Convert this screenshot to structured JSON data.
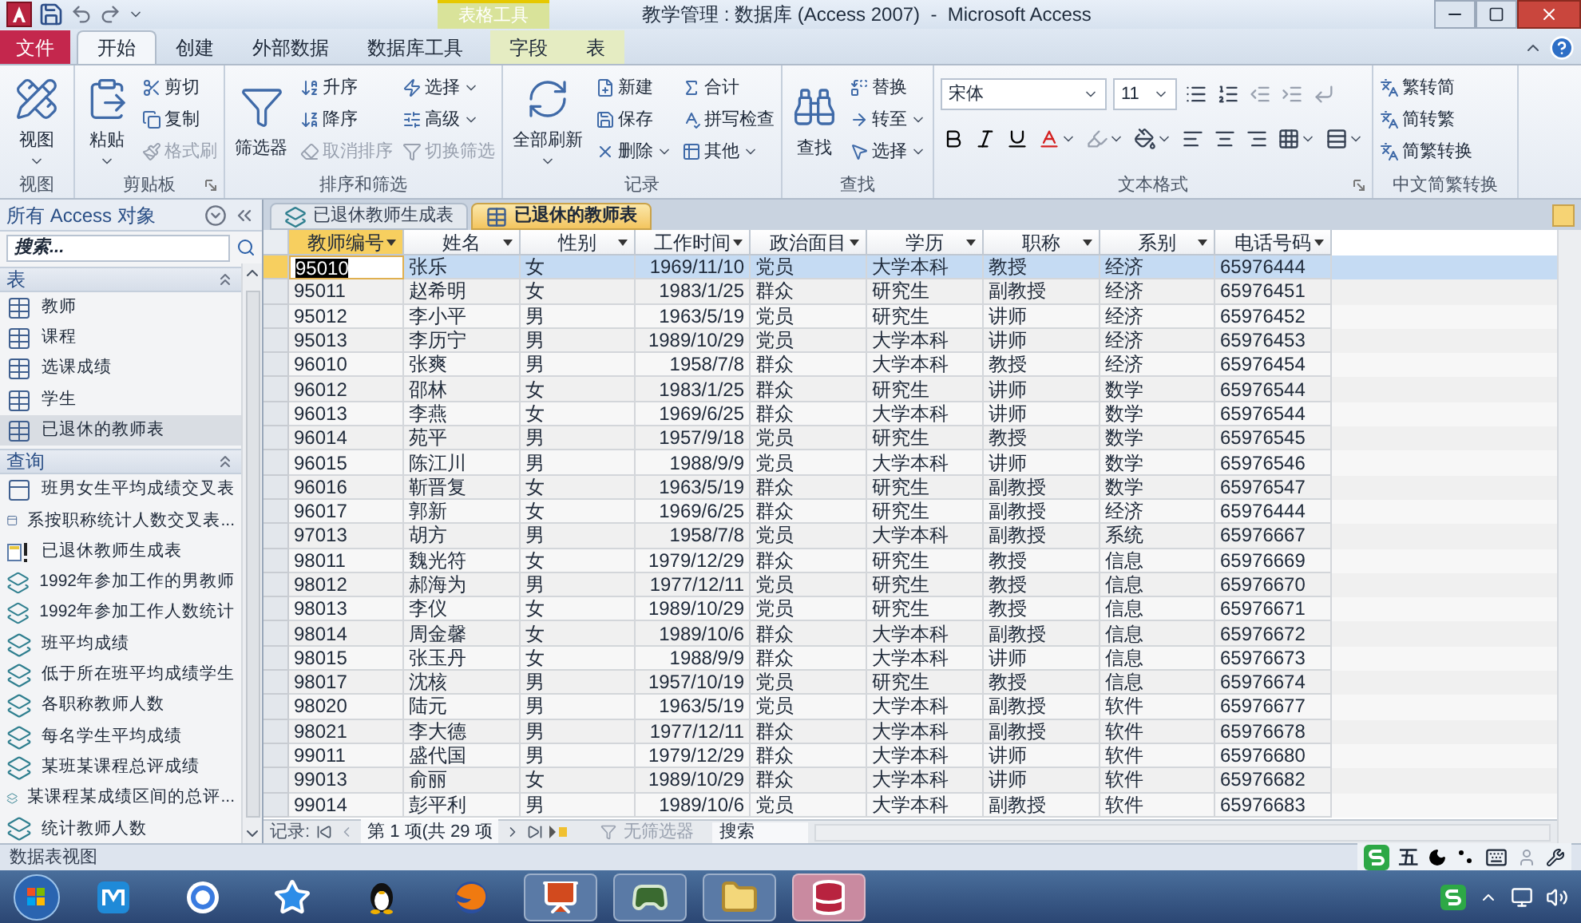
{
  "window": {
    "title": "教学管理 : 数据库 (Access 2007)  -  Microsoft Access"
  },
  "contextual_tab": {
    "label": "表格工具"
  },
  "ribbon_tabs": [
    {
      "label": "文件",
      "kind": "file",
      "selected": false
    },
    {
      "label": "开始",
      "kind": "normal",
      "selected": true
    },
    {
      "label": "创建",
      "kind": "normal",
      "selected": false
    },
    {
      "label": "外部数据",
      "kind": "normal",
      "selected": false
    },
    {
      "label": "数据库工具",
      "kind": "normal",
      "selected": false
    },
    {
      "label": "字段",
      "kind": "contextual",
      "selected": false
    },
    {
      "label": "表",
      "kind": "contextual",
      "selected": false
    }
  ],
  "ribbon_groups": [
    {
      "label": "视图",
      "kind": "buttons",
      "launcher": false,
      "items": [
        {
          "label": "视图",
          "kind": "large",
          "dropdown": true,
          "disabled": false
        }
      ]
    },
    {
      "label": "剪贴板",
      "kind": "buttons",
      "launcher": true,
      "items": [
        {
          "label": "粘贴",
          "kind": "large",
          "dropdown": true,
          "disabled": false
        },
        {
          "label": "剪切",
          "kind": "small",
          "dropdown": false,
          "disabled": false
        },
        {
          "label": "复制",
          "kind": "small",
          "dropdown": false,
          "disabled": false
        },
        {
          "label": "格式刷",
          "kind": "small",
          "dropdown": false,
          "disabled": true
        }
      ]
    },
    {
      "label": "排序和筛选",
      "kind": "buttons",
      "launcher": false,
      "items": [
        {
          "label": "筛选器",
          "kind": "large",
          "dropdown": false,
          "disabled": false
        },
        {
          "label": "升序",
          "kind": "small",
          "dropdown": false,
          "disabled": false
        },
        {
          "label": "降序",
          "kind": "small",
          "dropdown": false,
          "disabled": false
        },
        {
          "label": "取消排序",
          "kind": "small",
          "dropdown": false,
          "disabled": true
        },
        {
          "label": "选择",
          "kind": "small",
          "dropdown": true,
          "disabled": false
        },
        {
          "label": "高级",
          "kind": "small",
          "dropdown": true,
          "disabled": false
        },
        {
          "label": "切换筛选",
          "kind": "small",
          "dropdown": false,
          "disabled": true
        }
      ]
    },
    {
      "label": "记录",
      "kind": "buttons",
      "launcher": false,
      "items": [
        {
          "label": "全部刷新",
          "kind": "large",
          "dropdown": true,
          "disabled": false
        },
        {
          "label": "新建",
          "kind": "small",
          "dropdown": false,
          "disabled": false
        },
        {
          "label": "保存",
          "kind": "small",
          "dropdown": false,
          "disabled": false
        },
        {
          "label": "删除",
          "kind": "small",
          "dropdown": true,
          "disabled": false
        },
        {
          "label": "合计",
          "kind": "small",
          "dropdown": false,
          "disabled": false
        },
        {
          "label": "拼写检查",
          "kind": "small",
          "dropdown": false,
          "disabled": false
        },
        {
          "label": "其他",
          "kind": "small",
          "dropdown": true,
          "disabled": false
        }
      ]
    },
    {
      "label": "查找",
      "kind": "buttons",
      "launcher": false,
      "items": [
        {
          "label": "查找",
          "kind": "large",
          "dropdown": false,
          "disabled": false
        },
        {
          "label": "替换",
          "kind": "small",
          "dropdown": false,
          "disabled": false
        },
        {
          "label": "转至",
          "kind": "small",
          "dropdown": true,
          "disabled": false
        },
        {
          "label": "选择",
          "kind": "small",
          "dropdown": true,
          "disabled": false
        }
      ]
    },
    {
      "label": "文本格式",
      "kind": "text_format",
      "launcher": true,
      "font": {
        "value": "宋体"
      },
      "size": {
        "value": "11"
      }
    },
    {
      "label": "中文简繁转换",
      "kind": "buttons",
      "launcher": false,
      "items": [
        {
          "label": "繁转简",
          "kind": "small",
          "dropdown": false,
          "disabled": false
        },
        {
          "label": "简转繁",
          "kind": "small",
          "dropdown": false,
          "disabled": false
        },
        {
          "label": "简繁转换",
          "kind": "small",
          "dropdown": false,
          "disabled": false
        }
      ]
    }
  ],
  "nav_pane": {
    "title": "所有 Access 对象",
    "search": {
      "placeholder": "搜索..."
    },
    "groups": [
      {
        "label": "表",
        "items": [
          {
            "label": "教师",
            "kind": "table",
            "selected": false
          },
          {
            "label": "课程",
            "kind": "table",
            "selected": false
          },
          {
            "label": "选课成绩",
            "kind": "table",
            "selected": false
          },
          {
            "label": "学生",
            "kind": "table",
            "selected": false
          },
          {
            "label": "已退休的教师表",
            "kind": "table",
            "selected": true
          }
        ]
      },
      {
        "label": "查询",
        "items": [
          {
            "label": "班男女生平均成绩交叉表",
            "kind": "crosstab",
            "selected": false
          },
          {
            "label": "系按职称统计人数交叉表...",
            "kind": "crosstab",
            "selected": false
          },
          {
            "label": "已退休教师生成表",
            "kind": "make_table",
            "selected": false
          },
          {
            "label": "1992年参加工作的男教师",
            "kind": "select",
            "selected": false
          },
          {
            "label": "1992年参加工作人数统计",
            "kind": "select",
            "selected": false
          },
          {
            "label": "班平均成绩",
            "kind": "select",
            "selected": false
          },
          {
            "label": "低于所在班平均成绩学生",
            "kind": "select",
            "selected": false
          },
          {
            "label": "各职称教师人数",
            "kind": "select",
            "selected": false
          },
          {
            "label": "每名学生平均成绩",
            "kind": "select",
            "selected": false
          },
          {
            "label": "某班某课程总评成绩",
            "kind": "select",
            "selected": false
          },
          {
            "label": "某课程某成绩区间的总评...",
            "kind": "select",
            "selected": false
          },
          {
            "label": "统计教师人数",
            "kind": "select",
            "selected": false
          }
        ]
      }
    ]
  },
  "document_tabs": [
    {
      "label": "已退休教师生成表",
      "kind": "query",
      "selected": false
    },
    {
      "label": "已退休的教师表",
      "kind": "table",
      "selected": true
    }
  ],
  "table": {
    "columns": [
      {
        "label": "教师编号",
        "kind": "text",
        "selected": true
      },
      {
        "label": "姓名",
        "kind": "text",
        "selected": false
      },
      {
        "label": "性别",
        "kind": "text",
        "selected": false
      },
      {
        "label": "工作时间",
        "kind": "date",
        "selected": false
      },
      {
        "label": "政治面目",
        "kind": "text",
        "selected": false
      },
      {
        "label": "学历",
        "kind": "text",
        "selected": false
      },
      {
        "label": "职称",
        "kind": "text",
        "selected": false
      },
      {
        "label": "系别",
        "kind": "text",
        "selected": false
      },
      {
        "label": "电话号码",
        "kind": "text",
        "selected": false
      }
    ],
    "rows": [
      {
        "selected": true,
        "cells": [
          "95010",
          "张乐",
          "女",
          "1969/11/10",
          "党员",
          "大学本科",
          "教授",
          "经济",
          "65976444"
        ]
      },
      {
        "selected": false,
        "cells": [
          "95011",
          "赵希明",
          "女",
          "1983/1/25",
          "群众",
          "研究生",
          "副教授",
          "经济",
          "65976451"
        ]
      },
      {
        "selected": false,
        "cells": [
          "95012",
          "李小平",
          "男",
          "1963/5/19",
          "党员",
          "研究生",
          "讲师",
          "经济",
          "65976452"
        ]
      },
      {
        "selected": false,
        "cells": [
          "95013",
          "李历宁",
          "男",
          "1989/10/29",
          "党员",
          "大学本科",
          "讲师",
          "经济",
          "65976453"
        ]
      },
      {
        "selected": false,
        "cells": [
          "96010",
          "张爽",
          "男",
          "1958/7/8",
          "群众",
          "大学本科",
          "教授",
          "经济",
          "65976454"
        ]
      },
      {
        "selected": false,
        "cells": [
          "96012",
          "邵林",
          "女",
          "1983/1/25",
          "群众",
          "研究生",
          "讲师",
          "数学",
          "65976544"
        ]
      },
      {
        "selected": false,
        "cells": [
          "96013",
          "李燕",
          "女",
          "1969/6/25",
          "群众",
          "大学本科",
          "讲师",
          "数学",
          "65976544"
        ]
      },
      {
        "selected": false,
        "cells": [
          "96014",
          "苑平",
          "男",
          "1957/9/18",
          "党员",
          "研究生",
          "教授",
          "数学",
          "65976545"
        ]
      },
      {
        "selected": false,
        "cells": [
          "96015",
          "陈江川",
          "男",
          "1988/9/9",
          "党员",
          "大学本科",
          "讲师",
          "数学",
          "65976546"
        ]
      },
      {
        "selected": false,
        "cells": [
          "96016",
          "靳晋复",
          "女",
          "1963/5/19",
          "群众",
          "研究生",
          "副教授",
          "数学",
          "65976547"
        ]
      },
      {
        "selected": false,
        "cells": [
          "96017",
          "郭新",
          "女",
          "1969/6/25",
          "群众",
          "研究生",
          "副教授",
          "经济",
          "65976444"
        ]
      },
      {
        "selected": false,
        "cells": [
          "97013",
          "胡方",
          "男",
          "1958/7/8",
          "党员",
          "大学本科",
          "副教授",
          "系统",
          "65976667"
        ]
      },
      {
        "selected": false,
        "cells": [
          "98011",
          "魏光符",
          "女",
          "1979/12/29",
          "群众",
          "研究生",
          "教授",
          "信息",
          "65976669"
        ]
      },
      {
        "selected": false,
        "cells": [
          "98012",
          "郝海为",
          "男",
          "1977/12/11",
          "党员",
          "研究生",
          "教授",
          "信息",
          "65976670"
        ]
      },
      {
        "selected": false,
        "cells": [
          "98013",
          "李仪",
          "女",
          "1989/10/29",
          "党员",
          "研究生",
          "教授",
          "信息",
          "65976671"
        ]
      },
      {
        "selected": false,
        "cells": [
          "98014",
          "周金馨",
          "女",
          "1989/10/6",
          "群众",
          "大学本科",
          "副教授",
          "信息",
          "65976672"
        ]
      },
      {
        "selected": false,
        "cells": [
          "98015",
          "张玉丹",
          "女",
          "1988/9/9",
          "群众",
          "大学本科",
          "讲师",
          "信息",
          "65976673"
        ]
      },
      {
        "selected": false,
        "cells": [
          "98017",
          "沈核",
          "男",
          "1957/10/19",
          "党员",
          "研究生",
          "教授",
          "信息",
          "65976674"
        ]
      },
      {
        "selected": false,
        "cells": [
          "98020",
          "陆元",
          "男",
          "1963/5/19",
          "党员",
          "大学本科",
          "副教授",
          "软件",
          "65976677"
        ]
      },
      {
        "selected": false,
        "cells": [
          "98021",
          "李大德",
          "男",
          "1977/12/11",
          "群众",
          "大学本科",
          "副教授",
          "软件",
          "65976678"
        ]
      },
      {
        "selected": false,
        "cells": [
          "99011",
          "盛代国",
          "男",
          "1979/12/29",
          "群众",
          "大学本科",
          "讲师",
          "软件",
          "65976680"
        ]
      },
      {
        "selected": false,
        "cells": [
          "99013",
          "俞丽",
          "女",
          "1989/10/29",
          "群众",
          "大学本科",
          "讲师",
          "软件",
          "65976682"
        ]
      },
      {
        "selected": false,
        "cells": [
          "99014",
          "彭平利",
          "男",
          "1989/10/6",
          "党员",
          "大学本科",
          "副教授",
          "软件",
          "65976683"
        ]
      }
    ]
  },
  "record_navigator": {
    "label": "记录:",
    "position": "第 1 项(共 29 项",
    "filter": {
      "label": "无筛选器",
      "disabled": true
    },
    "search": {
      "placeholder": "搜索"
    }
  },
  "status_bar": {
    "view": "数据表视图",
    "ime_mode": "五"
  },
  "taskbar": {
    "apps": [
      {
        "kind": "browser_m",
        "open": false,
        "active": false
      },
      {
        "kind": "browser_ring",
        "open": false,
        "active": false
      },
      {
        "kind": "star",
        "open": false,
        "active": false
      },
      {
        "kind": "penguin",
        "open": false,
        "active": false
      },
      {
        "kind": "fox",
        "open": false,
        "active": false
      },
      {
        "kind": "slides",
        "open": true,
        "active": false
      },
      {
        "kind": "tool",
        "open": true,
        "active": false
      },
      {
        "kind": "folder",
        "open": true,
        "active": false
      },
      {
        "kind": "database",
        "open": true,
        "active": true
      }
    ]
  }
}
